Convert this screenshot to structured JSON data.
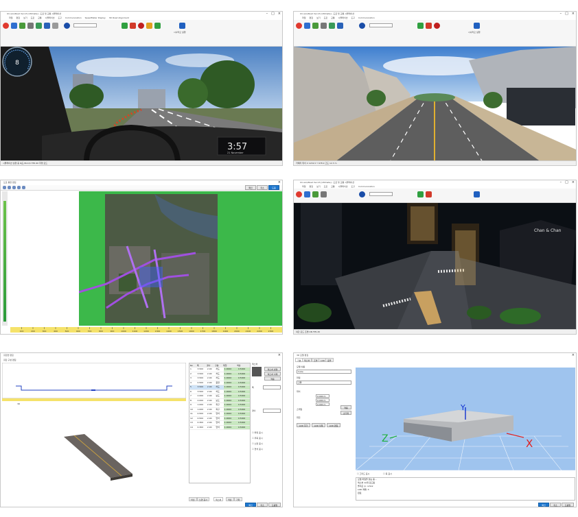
{
  "colors": {
    "sky": "#5f8fc9",
    "grass_green": "#3cb84a",
    "night_sky": "#0b0f14",
    "road": "#6e6e6e",
    "viewer_blue": "#9fc4ee",
    "accent_blue": "#1e78d0"
  },
  "simulator_app": {
    "title": "UC-win/Road Ver.13 [Ultimate] - 도로 및 교통 시뮬레이션",
    "menus": [
      "파일",
      "편집",
      "보기",
      "도로",
      "교통",
      "시뮬레이션",
      "도구",
      "Communication",
      "SpeedMeter Display",
      "3D Road Alignment"
    ],
    "run_label": "시나리오 실행"
  },
  "panel_driving": {
    "clock": "3:57",
    "clock_sub": "21 November",
    "speed": "8",
    "status": "시뮬레이션 실행 중    속도 8km/h    FPS 60    주행 모드"
  },
  "panel_street": {
    "status": "카메라 위치    X 1234.5    Y 678.9    고도 12.3 m"
  },
  "panel_map": {
    "title": "도로 평면 편집",
    "ok": "확인",
    "cancel": "취소",
    "help": "도움",
    "ruler_ticks": [
      "100",
      "200",
      "300",
      "400",
      "500",
      "600",
      "700",
      "800",
      "900",
      "1000",
      "1100",
      "1200",
      "1300",
      "1400",
      "1500",
      "1600",
      "1700",
      "1800",
      "1900",
      "2000",
      "2100",
      "2200",
      "2300"
    ]
  },
  "panel_night": {
    "sign_text": "Chan & Chan",
    "status": "야간 모드    조명 ON    FPS 45"
  },
  "panel_cross": {
    "title": "횡단면 편집",
    "profile_title": "횡단 구성 편집",
    "view_label": "3D",
    "table_headers": [
      "No",
      "폭",
      "경사",
      "구분",
      "재질",
      "색상"
    ],
    "rows": [
      [
        "1",
        "3.500",
        "2.00",
        "차도",
        "1.0000",
        "0.5000"
      ],
      [
        "2",
        "3.500",
        "2.00",
        "차도",
        "1.0000",
        "0.5000"
      ],
      [
        "3",
        "3.500",
        "2.00",
        "차도",
        "1.0000",
        "0.5000"
      ],
      [
        "4",
        "0.500",
        "2.00",
        "중앙",
        "1.0000",
        "0.5000"
      ],
      [
        "5",
        "3.500",
        "2.00",
        "차도",
        "1.0000",
        "0.5000"
      ],
      [
        "6",
        "3.500",
        "2.00",
        "차도",
        "1.0000",
        "0.5000"
      ],
      [
        "7",
        "2.000",
        "2.00",
        "보도",
        "1.0000",
        "0.5000"
      ],
      [
        "8",
        "2.000",
        "2.00",
        "보도",
        "1.0000",
        "0.5000"
      ],
      [
        "9",
        "1.000",
        "2.00",
        "측구",
        "1.0000",
        "0.5000"
      ],
      [
        "10",
        "1.000",
        "2.00",
        "측구",
        "1.0000",
        "0.5000"
      ],
      [
        "11",
        "0.500",
        "2.00",
        "연석",
        "1.0000",
        "0.5000"
      ],
      [
        "12",
        "0.500",
        "2.00",
        "연석",
        "1.0000",
        "0.5000"
      ],
      [
        "13",
        "0.300",
        "2.00",
        "연석",
        "1.0000",
        "0.5000"
      ],
      [
        "14",
        "0.300",
        "2.00",
        "연석",
        "1.0000",
        "0.5000"
      ]
    ],
    "texture_title": "텍스처",
    "texture_buttons": [
      "텍스처 변경",
      "텍스처 삭제",
      "적용"
    ],
    "width_label": "폭",
    "slope_label": "경사",
    "option_labels": [
      "좌측 표시",
      "우측 표시",
      "노면 표시",
      "연석 표시"
    ],
    "bottom_tabs": [
      "차선",
      "노면 표시",
      "텍스처",
      "색상",
      "기타"
    ],
    "ok": "확인",
    "cancel": "취소",
    "help": "도움말"
  },
  "panel_model": {
    "title": "3D 모델 편집",
    "tabs": [
      "기본",
      "텍스처",
      "조명",
      "LOD",
      "충돌"
    ],
    "name_label": "모델 이름",
    "name_value": "Cube",
    "file_label": "파일",
    "file_value": "건물",
    "position_label": "위치",
    "scale_label": "스케일",
    "rotation_label": "회전",
    "coord_values": [
      "0.000 m",
      "0.000 m",
      "0.000 m"
    ],
    "apply": "적용",
    "reset": "초기화",
    "lod_buttons": [
      "LOD 추가",
      "LOD 삭제",
      "LOD 편집"
    ],
    "axis_x": "X",
    "axis_y": "Y",
    "axis_z": "Z",
    "check_a": "그리드 표시",
    "check_b": "축 표시",
    "log_lines": [
      "모델 파일을 읽는 중...",
      "텍스처 12개 로드됨",
      "폴리곤 수: 4,512",
      "LOD 레벨: 3",
      "완료"
    ],
    "ok": "확인",
    "cancel": "취소",
    "help": "도움말"
  }
}
